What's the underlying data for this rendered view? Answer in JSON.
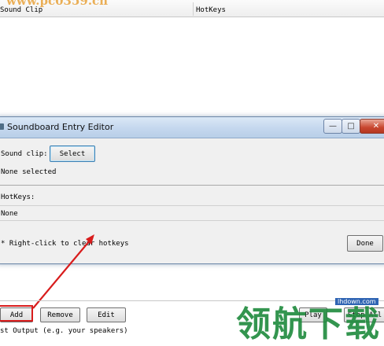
{
  "watermark_text": "www.pc0359.cn",
  "main_list": {
    "columns": [
      "Sound Clip",
      "HotKeys"
    ]
  },
  "dialog": {
    "title": "Soundboard Entry Editor",
    "window_controls": {
      "minimize": "—",
      "maximize": "□",
      "close": "✕"
    },
    "sound_clip_label": "Sound clip:",
    "select_label": "Select",
    "selected_value": "None selected",
    "hotkeys_label": "HotKeys:",
    "hotkeys_value": "None",
    "hint": "* Right-click to clear hotkeys",
    "done_label": "Done"
  },
  "toolbar": {
    "add_label": "Add",
    "remove_label": "Remove",
    "edit_label": "Edit",
    "play_label": "Play",
    "stop_label": "Stop All"
  },
  "output_label": "st Output (e.g. your speakers)",
  "brand_watermark": {
    "text": "领航下载",
    "sub": "lhdown.com"
  },
  "colors": {
    "annotation": "#d81c1c",
    "brand": "#1e8a3c"
  }
}
